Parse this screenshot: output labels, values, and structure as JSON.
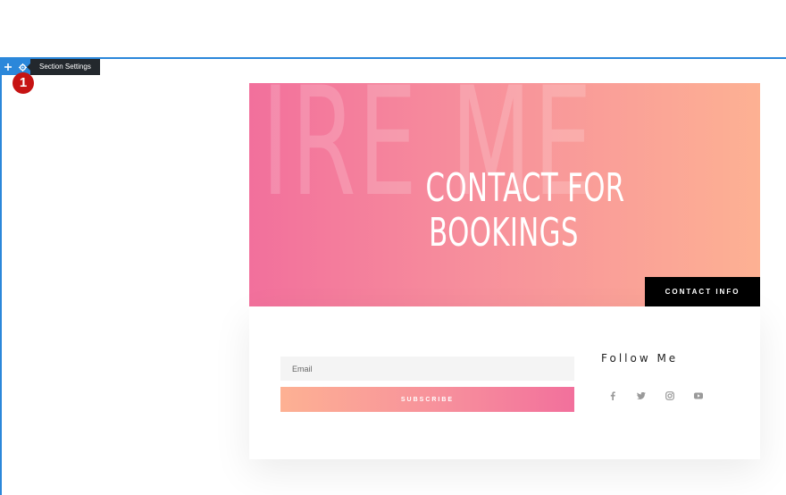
{
  "builder": {
    "tooltip": "Section Settings",
    "step_number": "1",
    "accent_color": "#2b87da",
    "icons": [
      "plus-icon",
      "gear-icon"
    ]
  },
  "hero": {
    "bg_text": "IRE ME",
    "title_line1": "CONTACT FOR",
    "title_line2": "BOOKINGS",
    "contact_button": "CONTACT INFO",
    "gradient": [
      "#f2709c",
      "#fdb193"
    ]
  },
  "form": {
    "email_placeholder": "Email",
    "subscribe_label": "SUBSCRIBE"
  },
  "social": {
    "title": "Follow Me",
    "icons": [
      "facebook-icon",
      "twitter-icon",
      "instagram-icon",
      "youtube-icon"
    ],
    "icon_color": "#9a9a9a"
  }
}
